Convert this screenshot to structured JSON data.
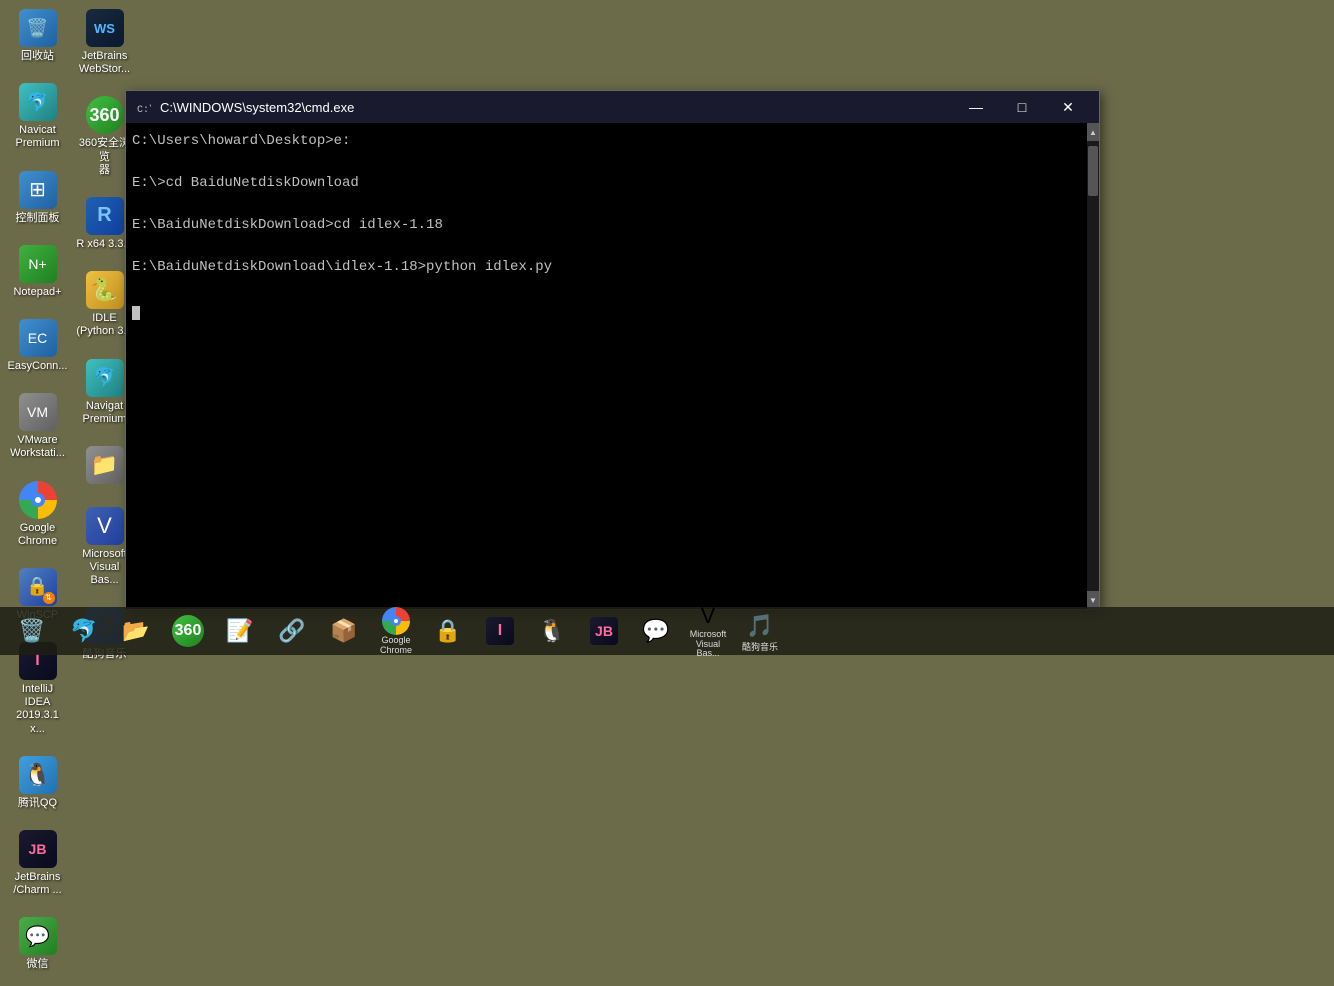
{
  "desktop": {
    "background": "#6b6b4a",
    "icons_col1": [
      {
        "id": "recycle-bin",
        "label": "回收站",
        "icon": "🗑️"
      },
      {
        "id": "navicat",
        "label": "Navicat\nPremium",
        "icon": "🐬"
      },
      {
        "id": "control-panel",
        "label": "控制面板",
        "icon": "⚙️"
      },
      {
        "id": "notepad-plus",
        "label": "Notepad+",
        "icon": "📝"
      },
      {
        "id": "easyconnect",
        "label": "EasyConn...",
        "icon": "🔗"
      },
      {
        "id": "vmware",
        "label": "VMware\nWorkstati...",
        "icon": "📦"
      },
      {
        "id": "google-chrome",
        "label": "Google\nChrome",
        "icon": "chrome"
      },
      {
        "id": "winscp",
        "label": "WinSCP",
        "icon": "🔒"
      },
      {
        "id": "intellij-idea",
        "label": "IntelliJ IDEA\n2019.3.1 x...",
        "icon": "I"
      },
      {
        "id": "qq",
        "label": "腾讯QQ",
        "icon": "🐧"
      },
      {
        "id": "jetbrains-charm",
        "label": "JetBrains\n/Charm ...",
        "icon": "J"
      },
      {
        "id": "wechat",
        "label": "微信",
        "icon": "💬"
      }
    ],
    "icons_col2": [
      {
        "id": "jetbrains-webstorm",
        "label": "JetBrains\nWebStor...",
        "icon": "W"
      },
      {
        "id": "360",
        "label": "360安全浏览\n器",
        "icon": "🛡️"
      },
      {
        "id": "r-x64",
        "label": "R x64 3.3.2",
        "icon": "R"
      },
      {
        "id": "idle-python",
        "label": "IDLE\n(Python 3...",
        "icon": "🐍"
      },
      {
        "id": "navicat2",
        "label": "Navigat\nPremium",
        "icon": "🐬"
      },
      {
        "id": "unknown1",
        "label": "",
        "icon": "📁"
      },
      {
        "id": "msvisual-basic",
        "label": "Microsoft\nVisual Bas...",
        "icon": "V"
      },
      {
        "id": "xiami-music",
        "label": "酷狗音乐",
        "icon": "🎵"
      }
    ]
  },
  "taskbar": {
    "icons": [
      {
        "id": "tb-recycle",
        "label": "回收站",
        "icon": "🗑️"
      },
      {
        "id": "tb-navicat",
        "label": "Navicat\nPremium",
        "icon": "🐬"
      },
      {
        "id": "tb-unknown",
        "label": "",
        "icon": "📂"
      },
      {
        "id": "tb-360",
        "label": "360安全浏览器",
        "icon": "🛡️"
      },
      {
        "id": "tb-notepad",
        "label": "Notepad+",
        "icon": "📝"
      },
      {
        "id": "tb-easyconn",
        "label": "EasyConn",
        "icon": "🔗"
      },
      {
        "id": "tb-vmware",
        "label": "VMware",
        "icon": "📦"
      },
      {
        "id": "tb-chrome",
        "label": "Google Chrome",
        "icon": "chrome"
      },
      {
        "id": "tb-winscp",
        "label": "WinSCP",
        "icon": "🔒"
      },
      {
        "id": "tb-idea",
        "label": "IntelliJ IDEA",
        "icon": "I"
      },
      {
        "id": "tb-qq",
        "label": "腾讯QQ",
        "icon": "🐧"
      },
      {
        "id": "tb-jetbrains",
        "label": "JetBrains",
        "icon": "J"
      },
      {
        "id": "tb-wechat",
        "label": "微信",
        "icon": "💬"
      },
      {
        "id": "tb-msvisual",
        "label": "Microsoft\nVisual Bas...",
        "icon": "V"
      },
      {
        "id": "tb-xiami",
        "label": "酷狗音乐",
        "icon": "🎵"
      }
    ]
  },
  "cmd_window": {
    "title": "C:\\WINDOWS\\system32\\cmd.exe",
    "lines": [
      "C:\\Users\\howard\\Desktop>e:",
      "",
      "E:\\>cd BaiduNetdiskDownload",
      "",
      "E:\\BaiduNetdiskDownload>cd idlex-1.18",
      "",
      "E:\\BaiduNetdiskDownload\\idlex-1.18>python idlex.py",
      ""
    ],
    "controls": {
      "minimize": "—",
      "maximize": "□",
      "close": "✕"
    }
  }
}
